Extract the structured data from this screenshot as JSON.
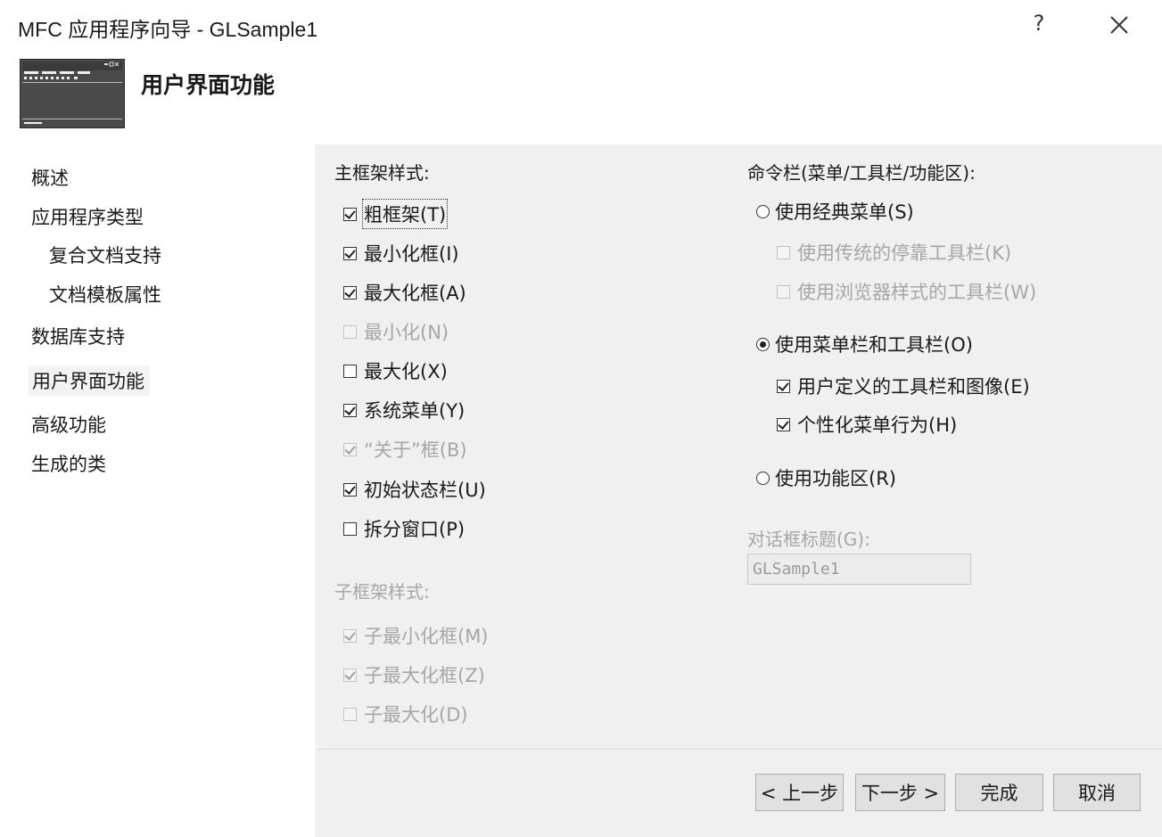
{
  "window": {
    "title": "MFC 应用程序向导 - GLSample1",
    "help_label": "?"
  },
  "header": {
    "title": "用户界面功能"
  },
  "nav": {
    "items": [
      {
        "label": "概述"
      },
      {
        "label": "应用程序类型"
      },
      {
        "label": "复合文档支持"
      },
      {
        "label": "文档模板属性"
      },
      {
        "label": "数据库支持"
      },
      {
        "label": "用户界面功能",
        "selected": true
      },
      {
        "label": "高级功能"
      },
      {
        "label": "生成的类"
      }
    ]
  },
  "main_frame": {
    "heading": "主框架样式:",
    "options": [
      {
        "label": "粗框架(T)",
        "checked": true,
        "enabled": true
      },
      {
        "label": "最小化框(I)",
        "checked": true,
        "enabled": true
      },
      {
        "label": "最大化框(A)",
        "checked": true,
        "enabled": true
      },
      {
        "label": "最小化(N)",
        "checked": false,
        "enabled": false
      },
      {
        "label": "最大化(X)",
        "checked": false,
        "enabled": true
      },
      {
        "label": "系统菜单(Y)",
        "checked": true,
        "enabled": true
      },
      {
        "label": "“关于”框(B)",
        "checked": true,
        "enabled": false
      },
      {
        "label": "初始状态栏(U)",
        "checked": true,
        "enabled": true
      },
      {
        "label": "拆分窗口(P)",
        "checked": false,
        "enabled": true
      }
    ]
  },
  "child_frame": {
    "heading": "子框架样式:",
    "options": [
      {
        "label": "子最小化框(M)",
        "checked": true,
        "enabled": false
      },
      {
        "label": "子最大化框(Z)",
        "checked": true,
        "enabled": false
      },
      {
        "label": "子最大化(D)",
        "checked": false,
        "enabled": false
      }
    ]
  },
  "command_bar": {
    "heading": "命令栏(菜单/工具栏/功能区):",
    "classic_menu": {
      "label": "使用经典菜单(S)",
      "selected": false
    },
    "classic_sub": [
      {
        "label": "使用传统的停靠工具栏(K)",
        "checked": false,
        "enabled": false
      },
      {
        "label": "使用浏览器样式的工具栏(W)",
        "checked": false,
        "enabled": false
      }
    ],
    "menubar_toolbar": {
      "label": "使用菜单栏和工具栏(O)",
      "selected": true
    },
    "menubar_sub": [
      {
        "label": "用户定义的工具栏和图像(E)",
        "checked": true,
        "enabled": true
      },
      {
        "label": "个性化菜单行为(H)",
        "checked": true,
        "enabled": true
      }
    ],
    "ribbon": {
      "label": "使用功能区(R)",
      "selected": false
    }
  },
  "dialog_title": {
    "label": "对话框标题(G):",
    "value": "GLSample1"
  },
  "buttons": {
    "prev": "< 上一步",
    "next": "下一步 >",
    "finish": "完成",
    "cancel": "取消"
  },
  "colors": {
    "panel": "#f0f0f0",
    "disabled_text": "#a6a6a6",
    "accent": "#1a1a1a"
  }
}
